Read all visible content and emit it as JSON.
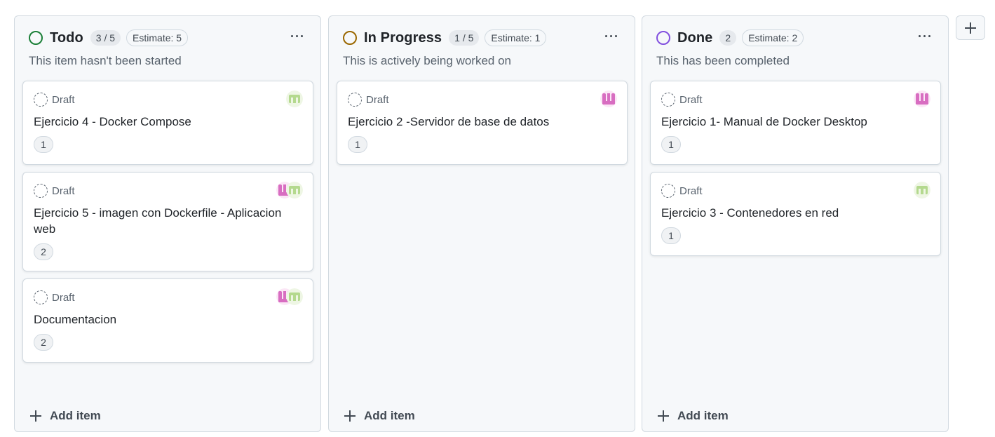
{
  "columns": [
    {
      "title": "Todo",
      "count": "3 / 5",
      "estimate": "Estimate: 5",
      "description": "This item hasn't been started",
      "status_color": "#1a7f37",
      "add_item_label": "Add item",
      "cards": [
        {
          "status": "Draft",
          "title": "Ejercicio 4 - Docker Compose",
          "number": "1",
          "avatars": [
            "green-avatar"
          ]
        },
        {
          "status": "Draft",
          "title": "Ejercicio 5 - imagen con Dockerfile - Aplicacion web",
          "number": "2",
          "avatars": [
            "pink-avatar",
            "green-avatar"
          ]
        },
        {
          "status": "Draft",
          "title": "Documentacion",
          "number": "2",
          "avatars": [
            "pink-avatar",
            "green-avatar"
          ]
        }
      ]
    },
    {
      "title": "In Progress",
      "count": "1 / 5",
      "estimate": "Estimate: 1",
      "description": "This is actively being worked on",
      "status_color": "#9a6700",
      "add_item_label": "Add item",
      "cards": [
        {
          "status": "Draft",
          "title": "Ejercicio 2 -Servidor de base de datos",
          "number": "1",
          "avatars": [
            "pink-avatar"
          ]
        }
      ]
    },
    {
      "title": "Done",
      "count": "2",
      "estimate": "Estimate: 2",
      "description": "This has been completed",
      "status_color": "#8250df",
      "add_item_label": "Add item",
      "cards": [
        {
          "status": "Draft",
          "title": "Ejercicio 1- Manual de Docker Desktop",
          "number": "1",
          "avatars": [
            "pink-avatar"
          ]
        },
        {
          "status": "Draft",
          "title": "Ejercicio 3 - Contenedores en red",
          "number": "1",
          "avatars": [
            "green-avatar"
          ]
        }
      ]
    }
  ],
  "icons": {
    "status": "circle-status-icon",
    "draft": "dashed-circle-draft-icon",
    "more": "kebab-menu-icon",
    "add": "plus-icon"
  },
  "colors": {
    "pink_avatar": "#d86dc1",
    "green_avatar": "#b4d98e"
  }
}
